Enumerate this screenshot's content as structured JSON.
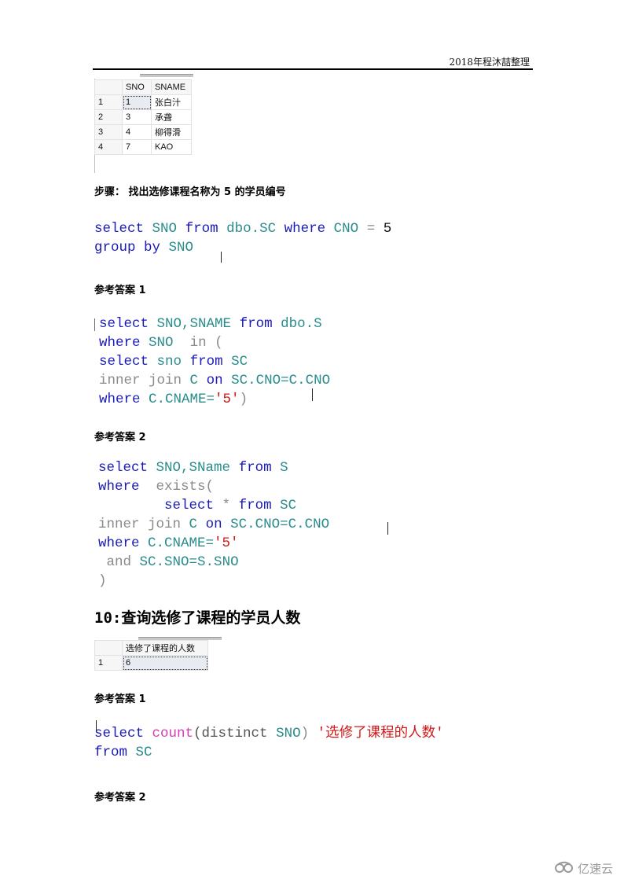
{
  "header": {
    "text": "2018年程沐喆整理"
  },
  "grid1": {
    "columns": [
      "",
      "SNO",
      "SNAME"
    ],
    "rows": [
      [
        "1",
        "1",
        "张白汁"
      ],
      [
        "2",
        "3",
        "承聋"
      ],
      [
        "3",
        "4",
        "柳得滑"
      ],
      [
        "4",
        "7",
        "KAO"
      ]
    ]
  },
  "step": {
    "text": "步骤：  找出选修课程名称为 5 的学员编号"
  },
  "code1": {
    "line1": [
      "select",
      "SNO",
      "from",
      "dbo.SC",
      "where",
      "CNO",
      "=",
      "5"
    ],
    "line2": [
      "group by",
      "SNO"
    ]
  },
  "answer1_label": "参考答案 1",
  "code2": {
    "l1": [
      "select",
      "SNO,SNAME",
      "from",
      "dbo.S"
    ],
    "l2": [
      "where",
      "SNO",
      "in",
      "("
    ],
    "l3": [
      "select",
      "sno",
      "from",
      "SC"
    ],
    "l4": [
      "inner join",
      "C",
      "on",
      "SC.CNO=C.CNO"
    ],
    "l5": [
      "where",
      "C.CNAME=",
      "'5'",
      ")"
    ]
  },
  "answer2_label": "参考答案 2",
  "code3": {
    "l1": [
      "select",
      "SNO,SName",
      "from",
      "S"
    ],
    "l2": [
      "where",
      "exists("
    ],
    "l3": [
      "select",
      "*",
      "from",
      "SC"
    ],
    "l4": [
      "inner join",
      "C",
      "on",
      "SC.CNO=C.CNO"
    ],
    "l5": [
      "where",
      "C.CNAME=",
      "'5'"
    ],
    "l6": [
      "and",
      "SC.SNO=S.SNO"
    ],
    "l7": [
      ")"
    ]
  },
  "section10": {
    "title": "10:查询选修了课程的学员人数"
  },
  "grid2": {
    "columns": [
      "",
      "选修了课程的人数"
    ],
    "rows": [
      [
        "1",
        "6"
      ]
    ]
  },
  "answer1b_label": "参考答案 1",
  "code4": {
    "l1": [
      "select",
      "count",
      "(distinct",
      "SNO",
      ")",
      "'选修了课程的人数'"
    ],
    "l2": [
      "from",
      "SC"
    ]
  },
  "answer2b_label": "参考答案 2",
  "watermark": {
    "text": "亿速云",
    "icon": "cloud-logo-icon"
  }
}
